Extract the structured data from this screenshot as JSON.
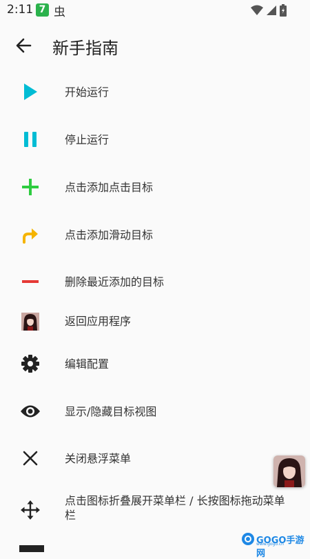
{
  "status_bar": {
    "time": "2:11",
    "app_badge": "7",
    "bug_badge": "虫"
  },
  "app_bar": {
    "title": "新手指南",
    "back_icon": "arrow-left-icon"
  },
  "menu": {
    "items": [
      {
        "label": "开始运行",
        "icon": "play-icon",
        "color": "#00bcd4"
      },
      {
        "label": "停止运行",
        "icon": "pause-icon",
        "color": "#00bcd4"
      },
      {
        "label": "点击添加点击目标",
        "icon": "plus-icon",
        "color": "#2ecc40"
      },
      {
        "label": "点击添加滑动目标",
        "icon": "swipe-arrow-icon",
        "color": "#f5b400"
      },
      {
        "label": "删除最近添加的目标",
        "icon": "minus-icon",
        "color": "#e53935"
      },
      {
        "label": "返回应用程序",
        "icon": "app-avatar-icon",
        "color": "#7a3b3b"
      },
      {
        "label": "编辑配置",
        "icon": "gear-icon",
        "color": "#222222"
      },
      {
        "label": "显示/隐藏目标视图",
        "icon": "eye-icon",
        "color": "#222222"
      },
      {
        "label": "关闭悬浮菜单",
        "icon": "close-icon",
        "color": "#222222"
      },
      {
        "label": "点击图标折叠展开菜单栏 / 长按图标拖动菜单栏",
        "icon": "move-icon",
        "color": "#222222"
      }
    ]
  },
  "floating_button": {
    "icon": "app-avatar-icon"
  },
  "watermark": {
    "text": "GOGO手游网",
    "url": "www.gogo.cn"
  }
}
